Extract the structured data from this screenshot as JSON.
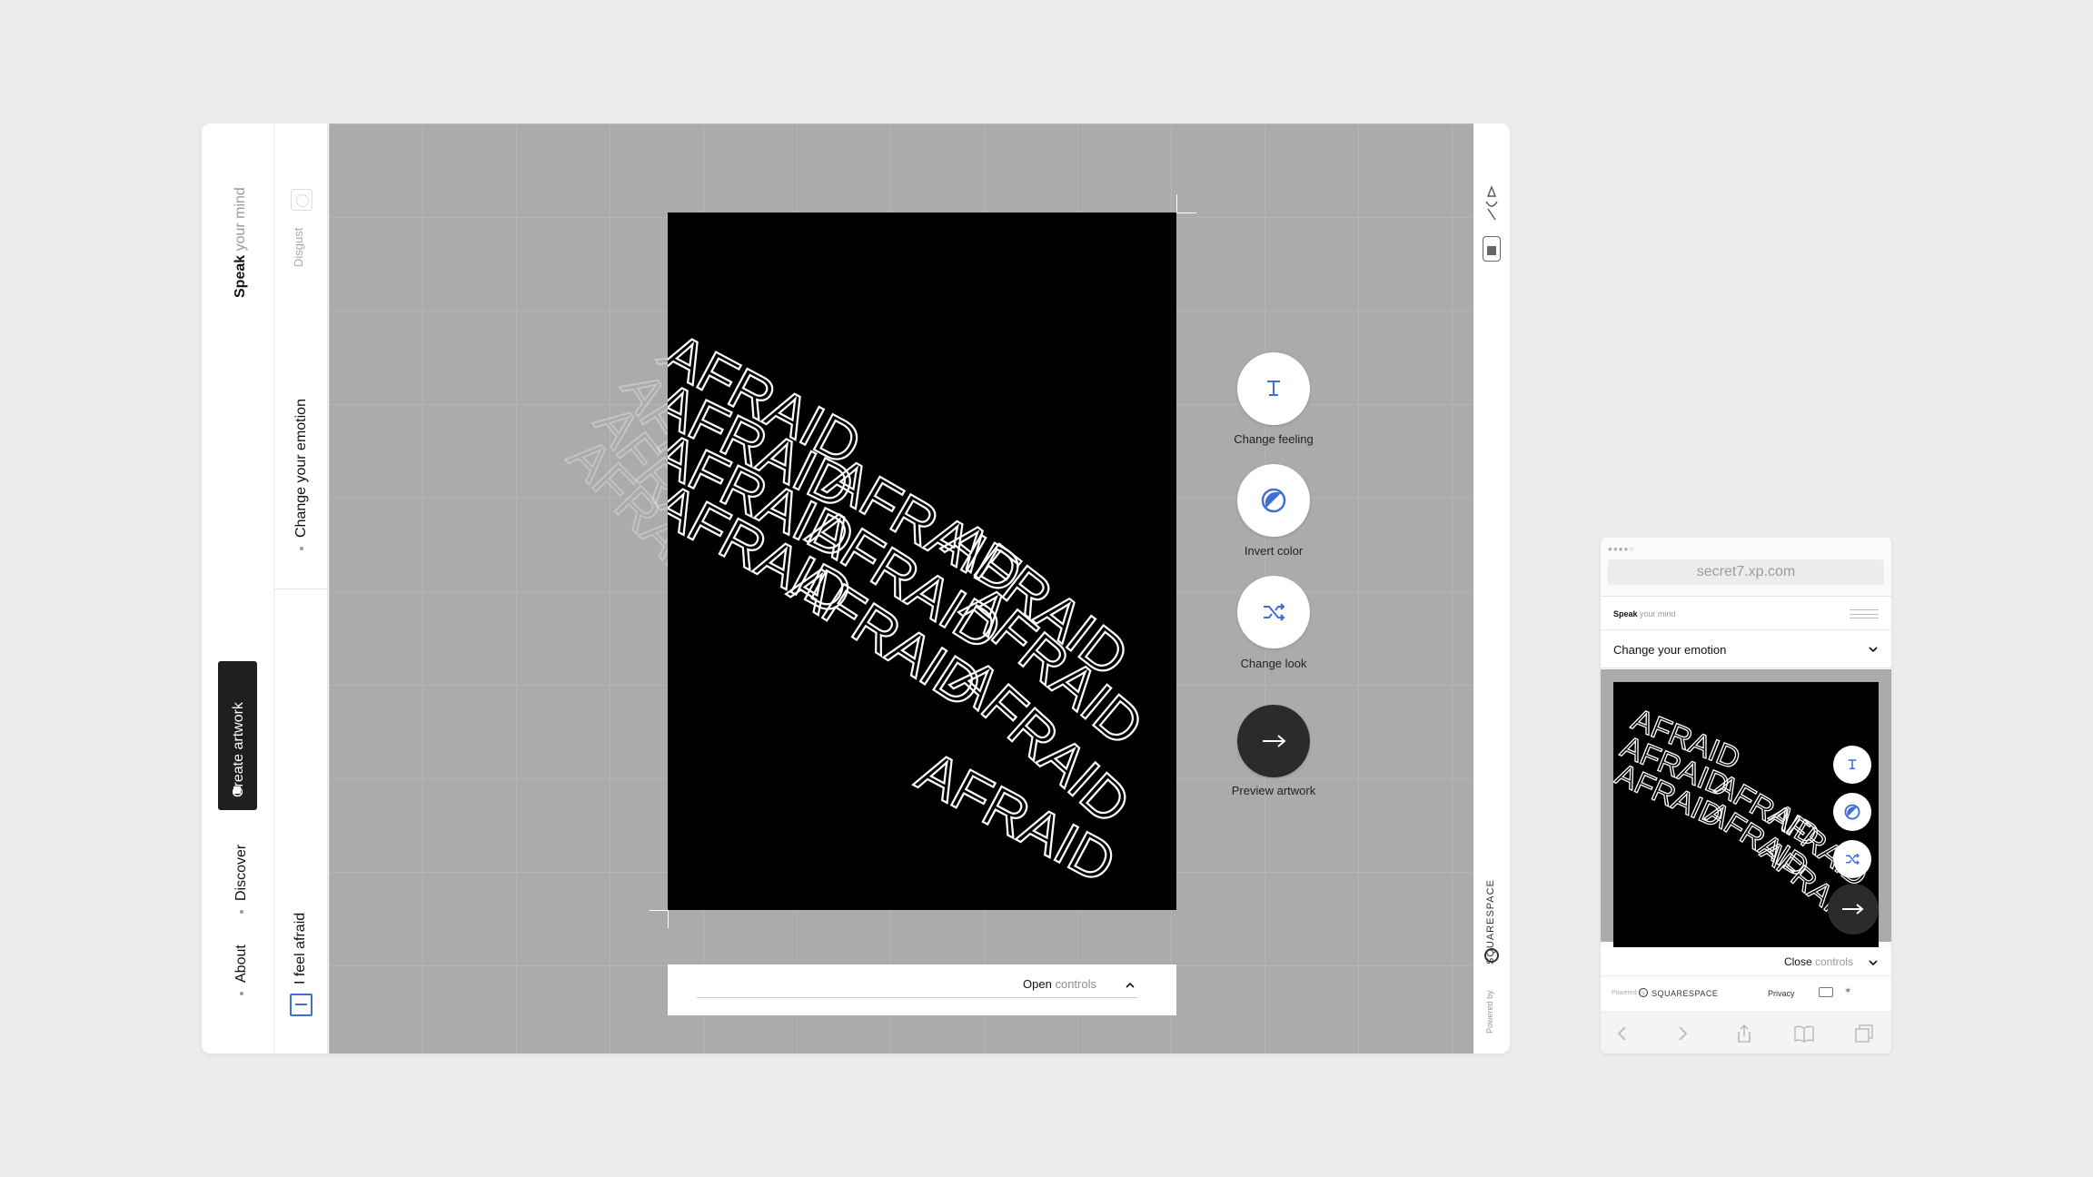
{
  "desktop": {
    "sidebar": {
      "brand_strong": "Speak",
      "brand_rest": " your mind",
      "create_label": "Create artwork",
      "nav": [
        "Discover",
        "About"
      ]
    },
    "subrail": {
      "option_label": "Disgust",
      "section_label": "Change your emotion",
      "current_label": "I feel afraid"
    },
    "artwork": {
      "word": "AFRAID",
      "background": "#000000",
      "text_color": "#ffffff"
    },
    "controls": {
      "change_feeling": "Change feeling",
      "invert_color": "Invert color",
      "change_look": "Change look",
      "preview": "Preview artwork",
      "accent": "#3d6fd6"
    },
    "bottom_bar": {
      "open_strong": "Open",
      "open_rest": " controls"
    },
    "right_rail": {
      "powered_by": "Powered by",
      "squarespace": "SQUARESPACE"
    }
  },
  "mobile": {
    "url": "secret7.xp.com",
    "brand_strong": "Speak",
    "brand_rest": " your mind",
    "emotion_label": "Change your emotion",
    "close_strong": "Close",
    "close_rest": " controls",
    "footer": {
      "powered_by": "Powered by",
      "squarespace": "SQUARESPACE",
      "privacy": "Privacy"
    }
  }
}
